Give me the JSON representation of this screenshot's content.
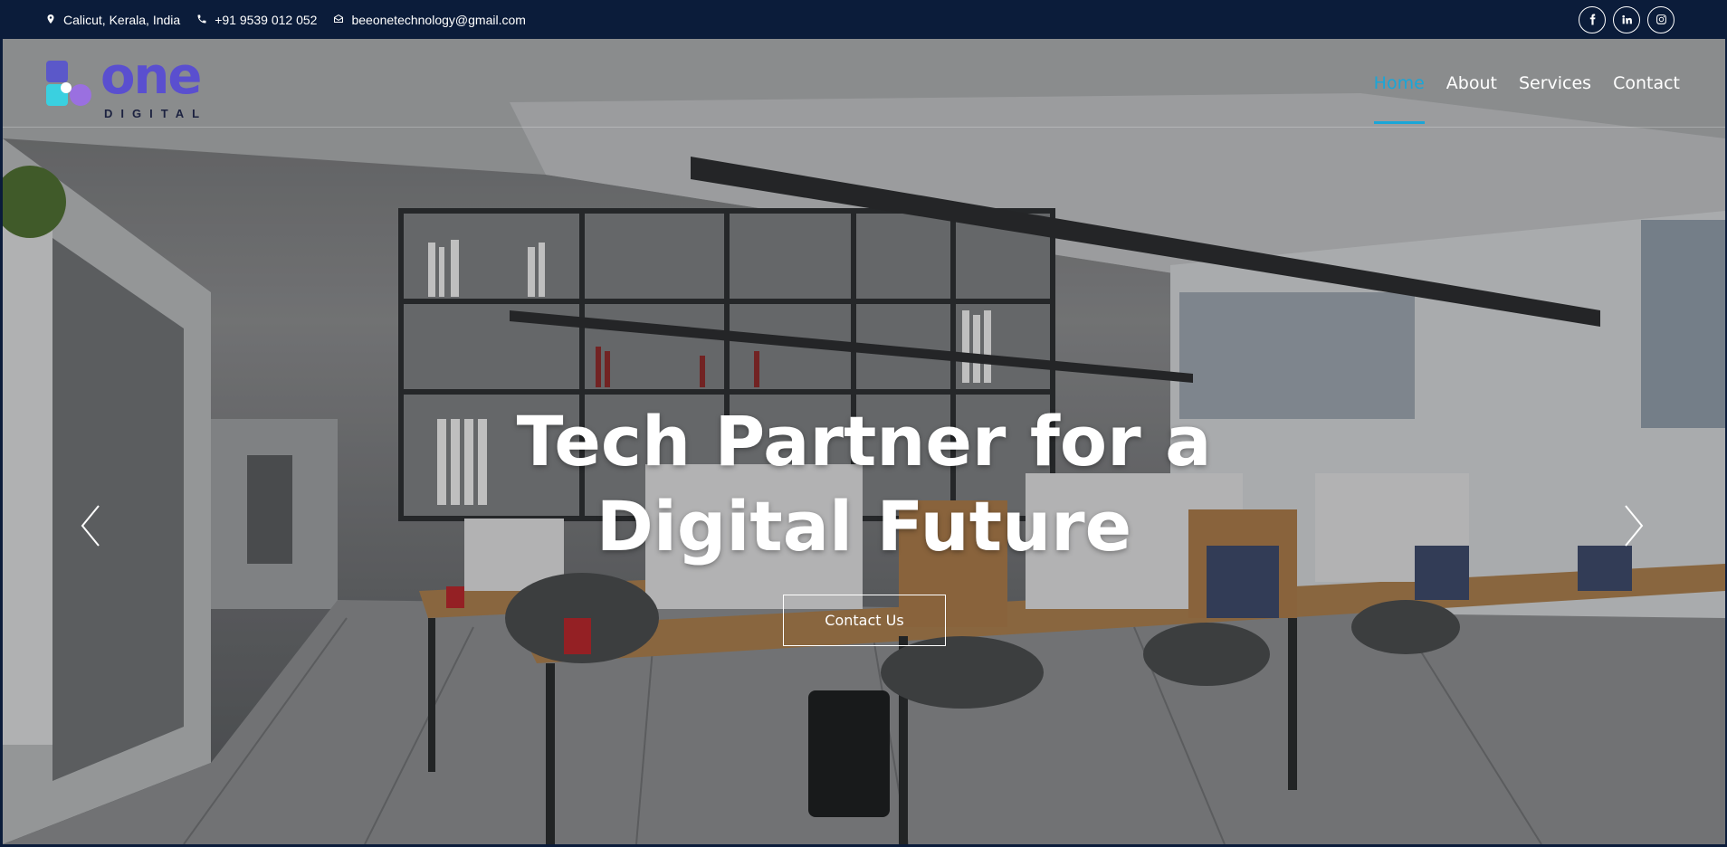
{
  "topbar": {
    "location": "Calicut, Kerala, India",
    "phone": "+91 9539 012 052",
    "email": "beeonetechnology@gmail.com",
    "socials": [
      "facebook-icon",
      "linkedin-icon",
      "instagram-icon"
    ]
  },
  "logo": {
    "wordmark": "one",
    "sub": "DIGITAL",
    "colors": {
      "primary": "#5b58c9",
      "secondary": "#9a70e0",
      "accent": "#3ad0e0"
    }
  },
  "nav": {
    "items": [
      {
        "label": "Home",
        "active": true
      },
      {
        "label": "About",
        "active": false
      },
      {
        "label": "Services",
        "active": false
      },
      {
        "label": "Contact",
        "active": false
      }
    ]
  },
  "hero": {
    "title_line1": "Tech Partner for a",
    "title_line2": "Digital Future",
    "cta_label": "Contact Us",
    "prev_icon": "chevron-left-icon",
    "next_icon": "chevron-right-icon"
  },
  "colors": {
    "topbar_bg": "#0b1c3a",
    "nav_active": "#1aa6d8",
    "text": "#ffffff"
  }
}
